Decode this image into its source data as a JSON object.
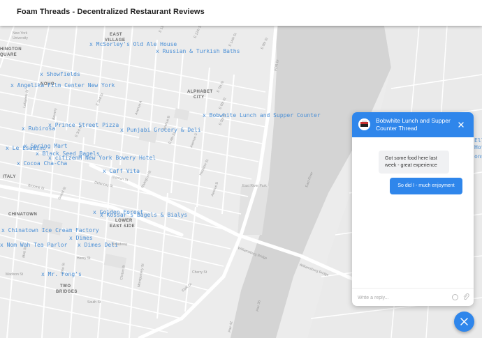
{
  "header": {
    "title": "Foam Threads - Decentralized Restaurant Reviews"
  },
  "map": {
    "neighborhoods": [
      {
        "id": "ev",
        "label": "EAST"
      },
      {
        "id": "ev2",
        "label": "VILLAGE"
      },
      {
        "id": "ac",
        "label": "ALPHABET"
      },
      {
        "id": "ac2",
        "label": "CITY"
      },
      {
        "id": "noho",
        "label": "NOHO"
      },
      {
        "id": "italy",
        "label": "ITALY"
      },
      {
        "id": "ct",
        "label": "CHINATOWN"
      },
      {
        "id": "les",
        "label": "LOWER"
      },
      {
        "id": "les2",
        "label": "EAST SIDE"
      },
      {
        "id": "tb",
        "label": "TWO"
      },
      {
        "id": "tb2",
        "label": "BRIDGES"
      },
      {
        "id": "hi",
        "label": "HINGTON"
      },
      {
        "id": "hi2",
        "label": "QUARE"
      },
      {
        "id": "nyu",
        "label": "New York"
      },
      {
        "id": "nyu2",
        "label": "University"
      }
    ],
    "streets": [
      {
        "id": "s1",
        "label": "E 12th St"
      },
      {
        "id": "s2",
        "label": "E 13th St"
      },
      {
        "id": "s3",
        "label": "E 14th St"
      },
      {
        "id": "s4",
        "label": "E 9th St"
      },
      {
        "id": "s5",
        "label": "E 7th St"
      },
      {
        "id": "s6",
        "label": "E 6th St"
      },
      {
        "id": "s7",
        "label": "E 5th St"
      },
      {
        "id": "s8",
        "label": "E 4th St"
      },
      {
        "id": "s9",
        "label": "E 3rd St"
      },
      {
        "id": "s10",
        "label": "E 2nd St"
      },
      {
        "id": "s11",
        "label": "Houston St"
      },
      {
        "id": "s12",
        "label": "Stanton St"
      },
      {
        "id": "s13",
        "label": "Rivington St"
      },
      {
        "id": "s14",
        "label": "Delancey St"
      },
      {
        "id": "s15",
        "label": "Broome St"
      },
      {
        "id": "s16",
        "label": "Grand St"
      },
      {
        "id": "s17",
        "label": "Henry St"
      },
      {
        "id": "s18",
        "label": "Madison St"
      },
      {
        "id": "s19",
        "label": "Cherry St"
      },
      {
        "id": "s20",
        "label": "South St"
      },
      {
        "id": "s21",
        "label": "FDR Dr"
      },
      {
        "id": "s22",
        "label": "FDR Dr"
      },
      {
        "id": "s23",
        "label": "Williamsburg Bridge"
      },
      {
        "id": "s24",
        "label": "Williamsburg Bridge"
      },
      {
        "id": "s25",
        "label": "East River Park"
      },
      {
        "id": "s26",
        "label": "Avenue A"
      },
      {
        "id": "s27",
        "label": "Avenue B"
      },
      {
        "id": "s28",
        "label": "Avenue C"
      },
      {
        "id": "s29",
        "label": "Avenue D"
      },
      {
        "id": "s30",
        "label": "Bowery"
      },
      {
        "id": "s31",
        "label": "Broadway"
      },
      {
        "id": "s32",
        "label": "Lafayette St"
      },
      {
        "id": "s33",
        "label": "Mott St"
      },
      {
        "id": "s34",
        "label": "Pike St"
      },
      {
        "id": "s35",
        "label": "Clinton St"
      },
      {
        "id": "s36",
        "label": "Montgomery St"
      },
      {
        "id": "s37",
        "label": "Pier 36"
      },
      {
        "id": "s38",
        "label": "Pier 42"
      },
      {
        "id": "s39",
        "label": "East River"
      }
    ],
    "markers": [
      {
        "id": "mcsorleys",
        "label": "x McSorley's Old Ale House"
      },
      {
        "id": "russian",
        "label": "x Russian & Turkish Baths"
      },
      {
        "id": "showfields",
        "label": "x Showfields"
      },
      {
        "id": "angelika",
        "label": "x Angelika Film Center New York"
      },
      {
        "id": "bobwhite",
        "label": "x Bobwhite Lunch and Supper Counter"
      },
      {
        "id": "rubirosa",
        "label": "x Rubirosa"
      },
      {
        "id": "prince",
        "label": "x Prince Street Pizza"
      },
      {
        "id": "punjabi",
        "label": "x Punjabi Grocery & Deli"
      },
      {
        "id": "spring",
        "label": "x Spring Mart"
      },
      {
        "id": "leesadino",
        "label": "x Le Esadino"
      },
      {
        "id": "blackseed",
        "label": "x Black Seed Bagels"
      },
      {
        "id": "citizenm",
        "label": "x citizenM New York Bowery Hotel"
      },
      {
        "id": "cococha",
        "label": "x Cocoa Cha-Cha"
      },
      {
        "id": "cafevita",
        "label": "x Caff Vita"
      },
      {
        "id": "goldenforest",
        "label": "x Golden Forest"
      },
      {
        "id": "kossars",
        "label": "x Kossar's Bagels & Bialys"
      },
      {
        "id": "chinatownice",
        "label": "x Chinatown Ice Cream Factory"
      },
      {
        "id": "dimes",
        "label": "x Dimes"
      },
      {
        "id": "nomwah",
        "label": "x Nom Wah Tea Parlor"
      },
      {
        "id": "dimesdeli",
        "label": "x Dimes Deli"
      },
      {
        "id": "mrfongs",
        "label": "x Mr. Fong's"
      }
    ],
    "edge_text": [
      "Ell",
      "Hot",
      "ons"
    ]
  },
  "chat": {
    "title": "Bobwhite Lunch and Supper Counter Thread",
    "messages": [
      {
        "direction": "incoming",
        "text": "Got some food here last week - great experience"
      },
      {
        "direction": "outgoing",
        "text": "So did I - much enjoyment"
      }
    ],
    "input_placeholder": "Write a reply...",
    "accent_color": "#2f86eb"
  },
  "icons": {
    "close": "close-icon",
    "emoji": "emoji-icon",
    "attach": "attachment-icon",
    "fab": "close-icon"
  }
}
